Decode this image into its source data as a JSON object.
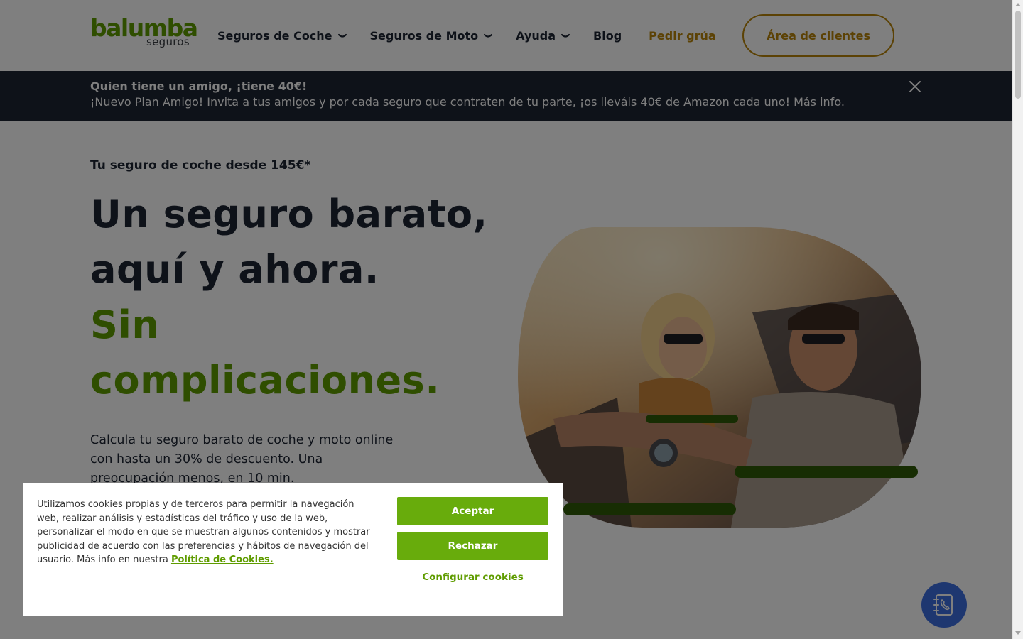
{
  "header": {
    "logo_brand": "balumba",
    "logo_sub": "seguros",
    "nav": [
      {
        "label": "Seguros de Coche",
        "icon": "chevron-down-icon"
      },
      {
        "label": "Seguros de Moto",
        "icon": "chevron-down-icon"
      },
      {
        "label": "Ayuda",
        "icon": "chevron-down-icon"
      },
      {
        "label": "Blog"
      },
      {
        "label": "Pedir grúa"
      }
    ],
    "client_area_label": "Área de clientes"
  },
  "banner": {
    "title": "Quien tiene un amigo, ¡tiene 40€!",
    "text": "¡Nuevo Plan Amigo! Invita a tus amigos y por cada seguro que contraten de tu parte, ¡os lleváis 40€ de Amazon cada uno! ",
    "link": "Más info",
    "trailing": ".",
    "close_icon": "close-icon"
  },
  "hero": {
    "eyebrow": "Tu seguro de coche desde 145€*",
    "title_line1": "Un seguro barato,",
    "title_line2": "aquí y ahora.",
    "title_green1": "Sin",
    "title_green2": "complicaciones.",
    "lead": "Calcula tu seguro barato de coche y moto online con hasta un 30% de descuento. Una preocupación menos, en 10 min."
  },
  "fab": {
    "icon": "phone-book-icon"
  },
  "cookie": {
    "text": "Utilizamos cookies propias y de terceros para permitir la navegación web, realizar análisis y estadísticas del tráfico y uso de la web, personalizar el modo en que se muestran algunos contenidos y mostrar publicidad de acuerdo con las preferencias y hábitos de navegación del usuario. Más info en nuestra ",
    "policy_link": "Política de Cookies.",
    "accept": "Aceptar",
    "reject": "Rechazar",
    "configure": "Configurar cookies"
  },
  "colors": {
    "brand_green": "#5f9c00",
    "button_green": "#68ac0c",
    "gold": "#b8850a",
    "navy": "#1d2433",
    "fab_blue": "#3d6fe0"
  }
}
